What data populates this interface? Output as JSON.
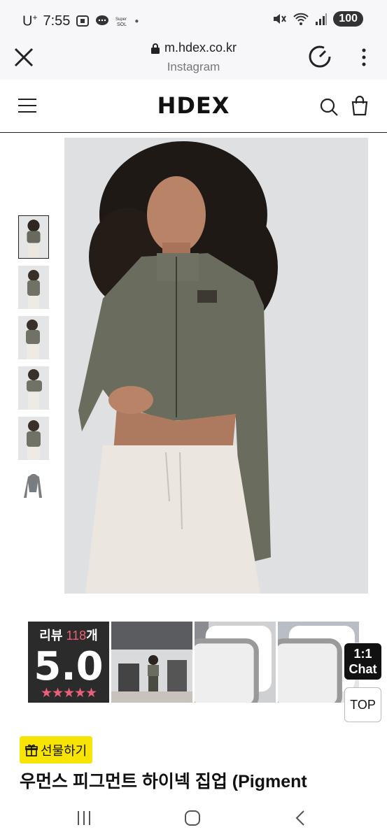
{
  "status_bar": {
    "carrier": "U",
    "carrier_sup": "+",
    "time": "7:55",
    "battery": "100"
  },
  "browser": {
    "url": "m.hdex.co.kr",
    "source": "Instagram"
  },
  "site": {
    "logo": "HDEX"
  },
  "gallery": {
    "thumbnail_count": 6,
    "active_index": 0
  },
  "reviews": {
    "label": "리뷰",
    "count": "118",
    "count_suffix": "개",
    "score": "5.0",
    "stars": "★★★★★",
    "rating_value": 5.0
  },
  "floating": {
    "chat_line1": "1:1",
    "chat_line2": "Chat",
    "top_label": "TOP"
  },
  "product": {
    "gift_label": "선물하기",
    "title": "우먼스 피그먼트 하이넥 집업 (Pigment"
  },
  "colors": {
    "gift_bg": "#f7e400",
    "accent_pink": "#e8607a",
    "review_card_bg": "#2b2b2b"
  }
}
